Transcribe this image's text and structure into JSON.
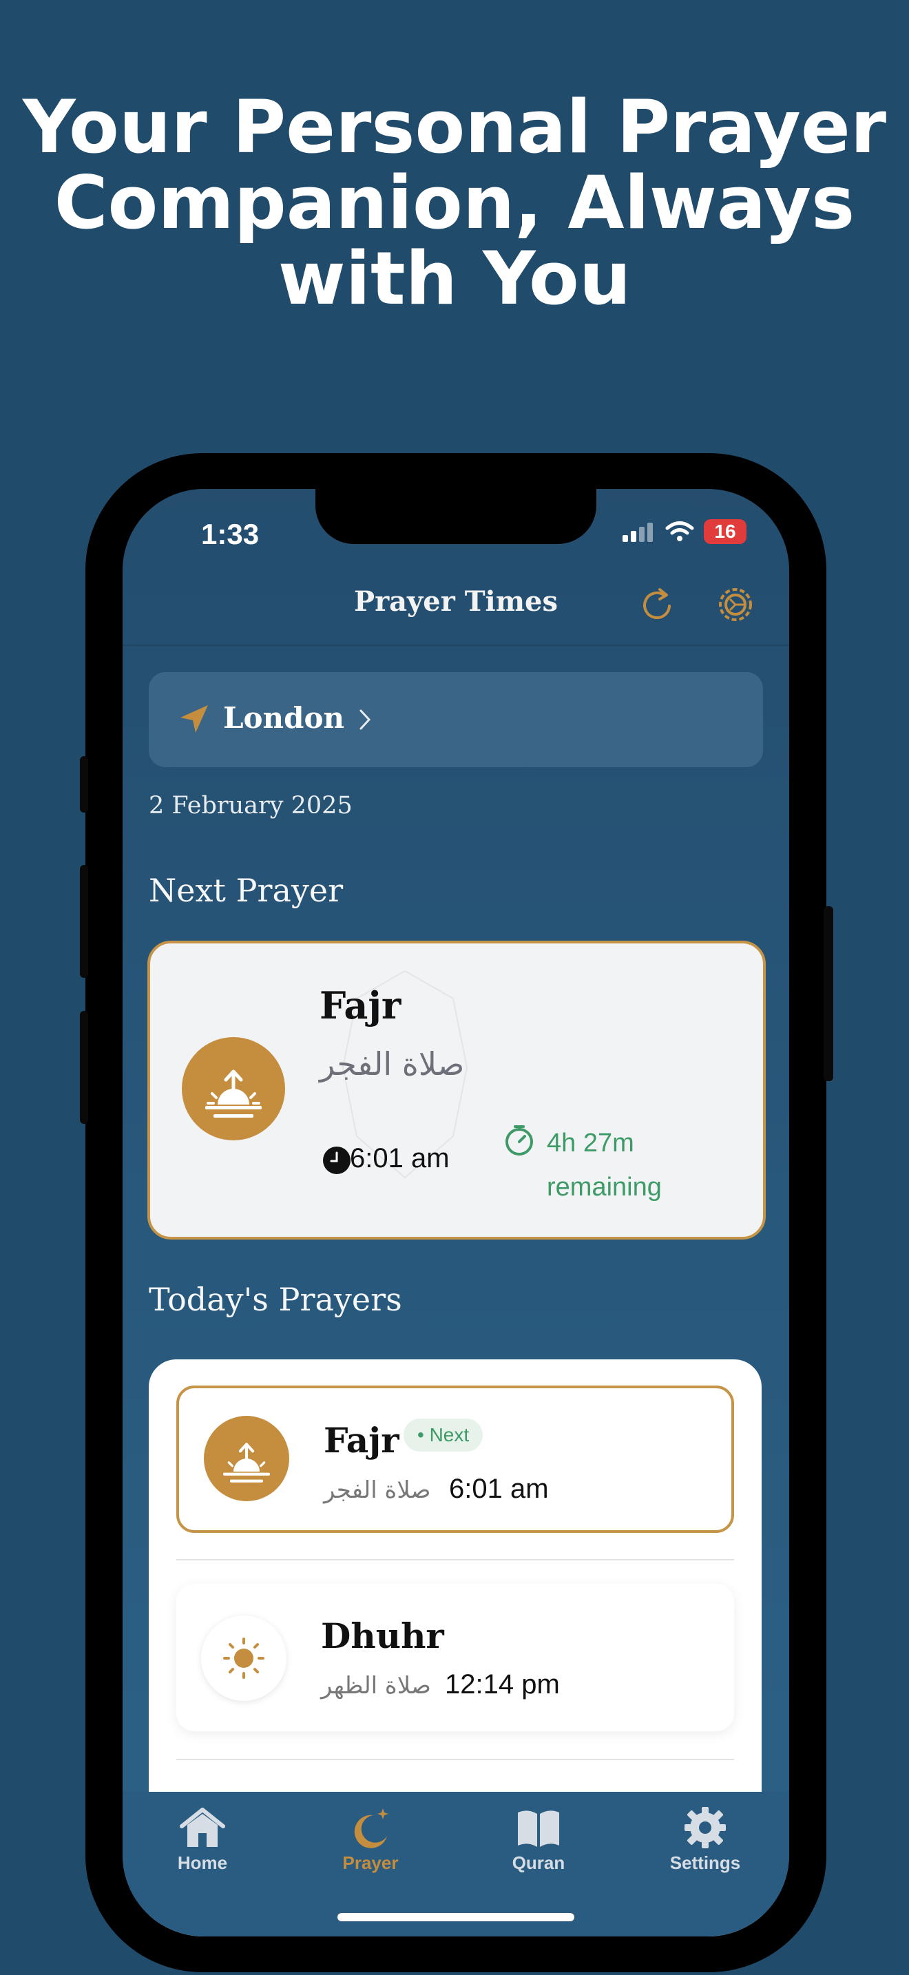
{
  "headline": {
    "line1": "Your Personal Prayer",
    "line2": "Companion, Always",
    "line3": "with You"
  },
  "status_bar": {
    "time": "1:33",
    "battery": "16"
  },
  "header": {
    "title": "Prayer Times",
    "refresh_icon": "refresh-icon",
    "settings_icon": "gear-icon"
  },
  "location": {
    "city": "London",
    "icon": "location-arrow-icon"
  },
  "date": "2 February 2025",
  "next_prayer": {
    "section_title": "Next Prayer",
    "name": "Fajr",
    "arabic": "صلاة الفجر",
    "time": "6:01 am",
    "remaining_line1": "4h 27m",
    "remaining_line2": "remaining",
    "icon": "sunrise-icon"
  },
  "todays_prayers": {
    "section_title": "Today's Prayers",
    "items": [
      {
        "name": "Fajr",
        "arabic": "صلاة الفجر",
        "time": "6:01 am",
        "badge": "• Next",
        "icon": "sunrise-icon"
      },
      {
        "name": "Dhuhr",
        "arabic": "صلاة الظهر",
        "time": "12:14 pm",
        "icon": "sun-icon"
      }
    ]
  },
  "tabs": [
    {
      "label": "Home",
      "icon": "home-icon",
      "active": false
    },
    {
      "label": "Prayer",
      "icon": "crescent-moon-icon",
      "active": true
    },
    {
      "label": "Quran",
      "icon": "book-icon",
      "active": false
    },
    {
      "label": "Settings",
      "icon": "gear-icon",
      "active": false
    }
  ],
  "colors": {
    "background": "#204b6b",
    "accent_gold": "#c48e3e",
    "success_green": "#3e9a66",
    "tab_inactive": "#d6dde4"
  }
}
